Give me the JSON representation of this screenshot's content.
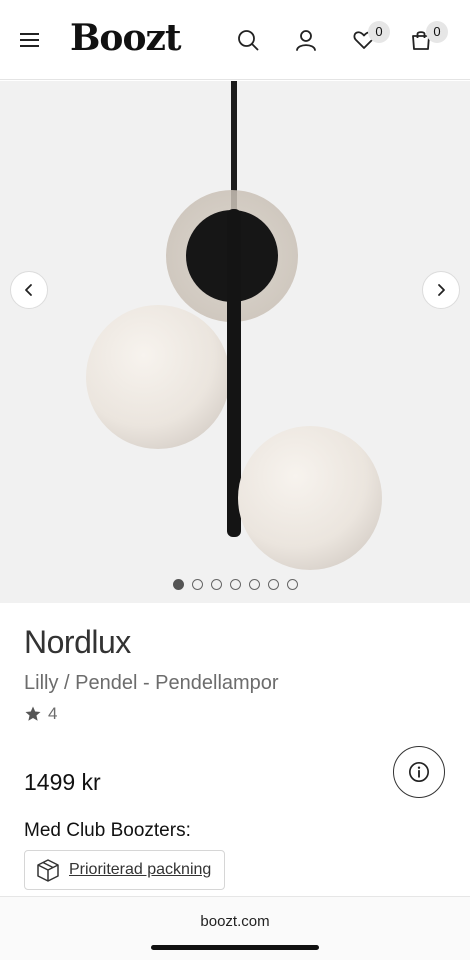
{
  "header": {
    "logo": "Boozt",
    "menu_icon": "hamburger-menu-icon",
    "search_icon": "search-icon",
    "account_icon": "user-icon",
    "wishlist_icon": "heart-icon",
    "wishlist_count": "0",
    "bag_icon": "shopping-bag-icon",
    "bag_count": "0"
  },
  "gallery": {
    "image_icon": "pendant-lamp-image",
    "prev_icon": "chevron-left-icon",
    "next_icon": "chevron-right-icon",
    "image_count": 7,
    "active_index": 0
  },
  "product": {
    "brand": "Nordlux",
    "subtitle": "Lilly / Pendel - Pendellampor",
    "rating_icon": "star-icon",
    "rating": "4",
    "info_icon": "info-icon",
    "price": "1499 kr",
    "club_label": "Med Club Boozters:",
    "perk_icon": "package-icon",
    "perk_label": "Prioriterad packning"
  },
  "browser": {
    "url": "boozt.com"
  },
  "colors": {
    "background": "#ffffff",
    "gallery_bg": "#f1f1f1",
    "text_primary": "#111111",
    "text_secondary": "#6c6c6c",
    "badge_bg": "#e6e6e6"
  }
}
